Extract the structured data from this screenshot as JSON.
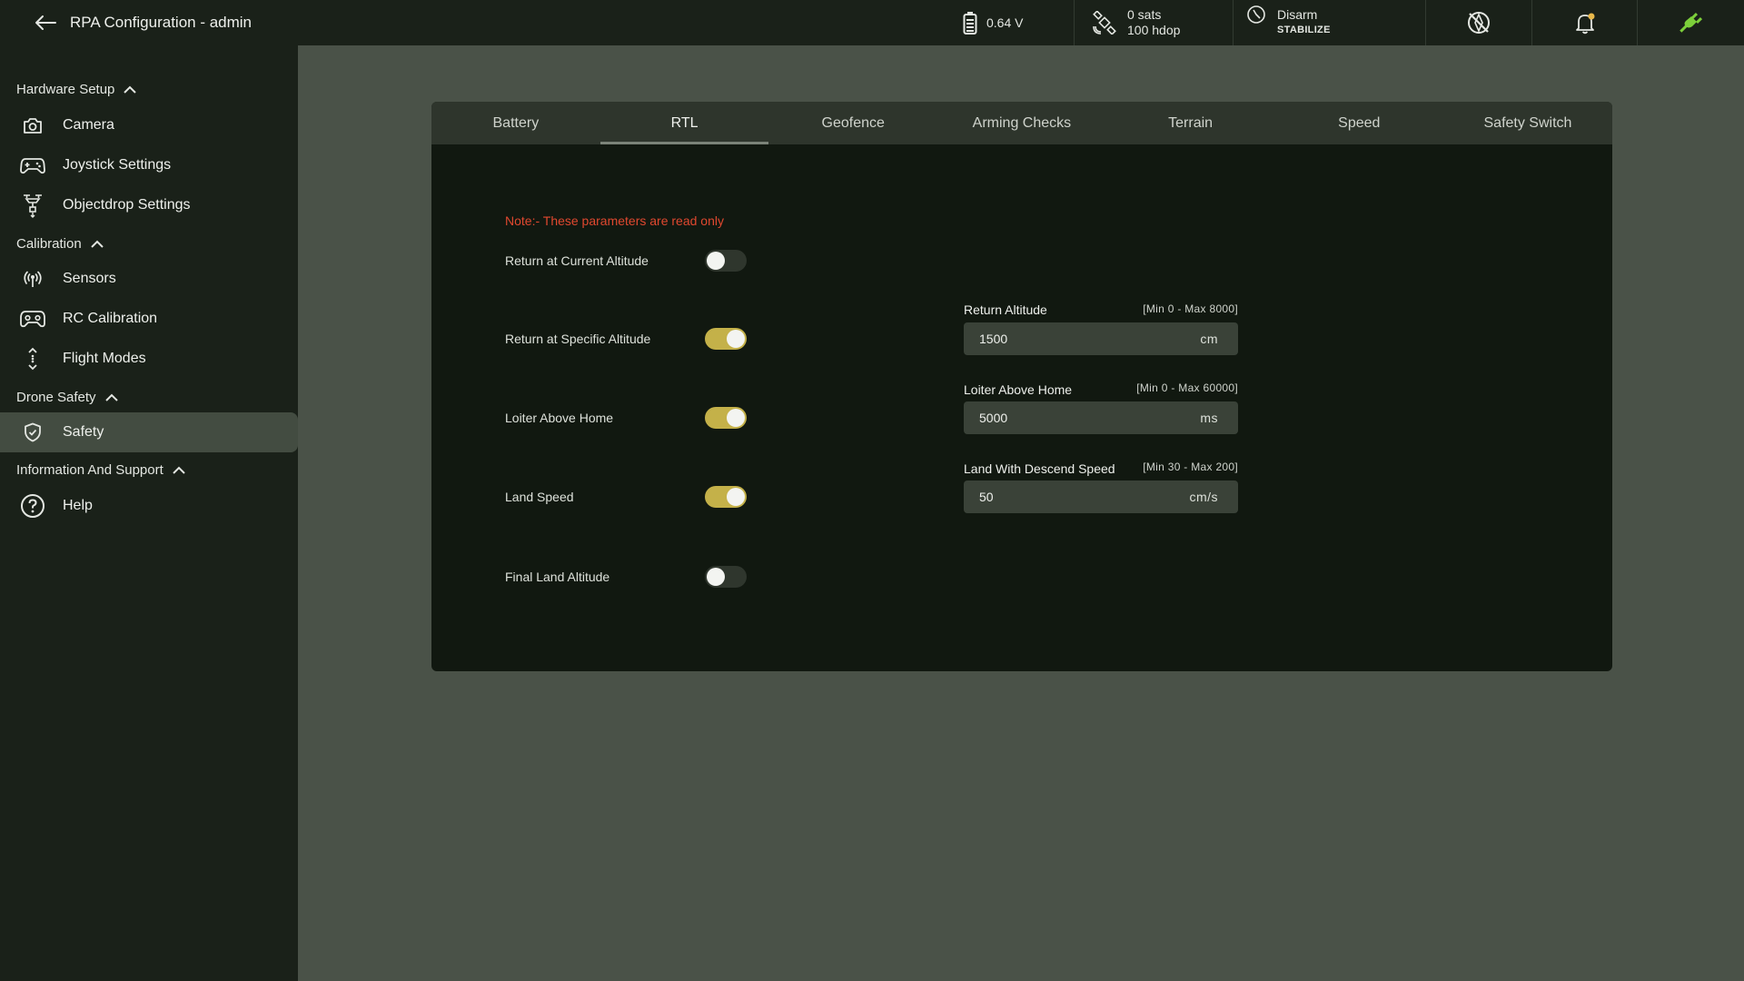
{
  "header": {
    "title": "RPA Configuration - admin",
    "battery_voltage": "0.64 V",
    "gps_sats": "0 sats",
    "gps_hdop": "100 hdop",
    "arm_state": "Disarm",
    "flight_mode": "STABILIZE",
    "icons": [
      "back-arrow-icon",
      "battery-icon",
      "satellite-icon",
      "arm-icon",
      "no-gps-compass-icon",
      "bell-icon",
      "plug-icon"
    ]
  },
  "sidebar": {
    "sections": [
      {
        "label": "Hardware Setup",
        "items": [
          {
            "label": "Camera",
            "icon": "camera-icon"
          },
          {
            "label": "Joystick Settings",
            "icon": "gamepad-icon"
          },
          {
            "label": "Objectdrop Settings",
            "icon": "drone-drop-icon"
          }
        ]
      },
      {
        "label": "Calibration",
        "items": [
          {
            "label": "Sensors",
            "icon": "sensor-icon"
          },
          {
            "label": "RC Calibration",
            "icon": "rc-controller-icon"
          },
          {
            "label": "Flight Modes",
            "icon": "flight-modes-icon"
          }
        ]
      },
      {
        "label": "Drone Safety",
        "items": [
          {
            "label": "Safety",
            "icon": "shield-check-icon",
            "active": true
          }
        ]
      },
      {
        "label": "Information And Support",
        "items": [
          {
            "label": "Help",
            "icon": "help-icon"
          }
        ]
      }
    ]
  },
  "tabs": [
    "Battery",
    "RTL",
    "Geofence",
    "Arming Checks",
    "Terrain",
    "Speed",
    "Safety Switch"
  ],
  "active_tab": "RTL",
  "rtl": {
    "note": "Note:- These parameters are read only",
    "toggles": [
      {
        "label": "Return at Current Altitude",
        "on": false
      },
      {
        "label": "Return at Specific Altitude",
        "on": true
      },
      {
        "label": "Loiter Above Home",
        "on": true
      },
      {
        "label": "Land Speed",
        "on": true
      },
      {
        "label": "Final Land Altitude",
        "on": false
      }
    ],
    "fields": [
      {
        "label": "Return Altitude",
        "range": "[Min 0 - Max 8000]",
        "value": "1500",
        "unit": "cm"
      },
      {
        "label": "Loiter Above Home",
        "range": "[Min 0 - Max 60000]",
        "value": "5000",
        "unit": "ms"
      },
      {
        "label": "Land With Descend Speed",
        "range": "[Min 30 - Max 200]",
        "value": "50",
        "unit": "cm/s"
      }
    ]
  },
  "colors": {
    "accent_toggle": "#c4b149",
    "note_red": "#e0482f",
    "plug_green": "#7ccf3a"
  }
}
